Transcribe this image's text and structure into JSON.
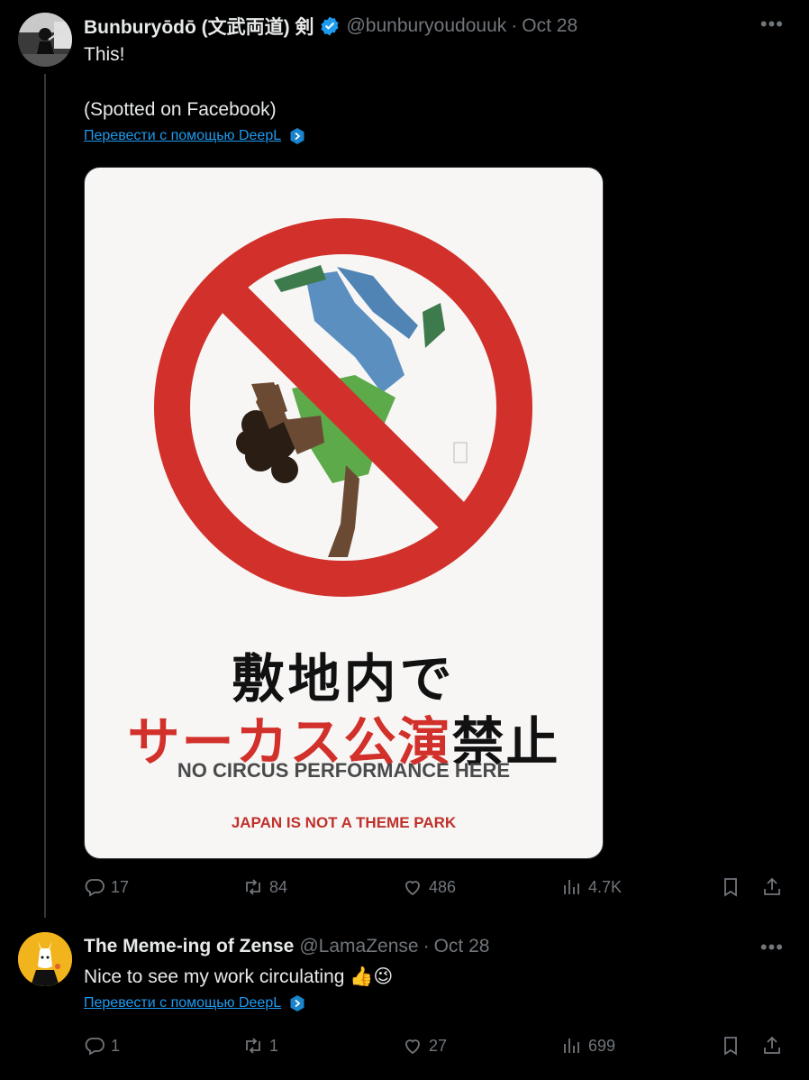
{
  "tweets": [
    {
      "name": "Bunburyōdō (文武両道) 剣",
      "handle": "@bunburyoudouuk",
      "separator": "·",
      "date": "Oct 28",
      "more_label": "•••",
      "text_lines": [
        "This!",
        "(Spotted on Facebook)"
      ],
      "translate_label": "Перевести с помощью DeepL",
      "poster": {
        "jp_line1": "敷地内で",
        "jp_line2_red": "サーカス公演",
        "jp_line2_black": "禁止",
        "en_line1": "NO CIRCUS PERFORMANCE HERE",
        "en_line2": "JAPAN IS NOT A THEME PARK"
      },
      "stats": {
        "replies": "17",
        "retweets": "84",
        "likes": "486",
        "views": "4.7K"
      }
    },
    {
      "name": "The Meme-ing of Zense",
      "handle": "@LamaZense",
      "separator": "·",
      "date": "Oct 28",
      "more_label": "•••",
      "text": "Nice to see my work circulating 👍😉",
      "translate_label": "Перевести с помощью DeepL",
      "stats": {
        "replies": "1",
        "retweets": "1",
        "likes": "27",
        "views": "699"
      }
    }
  ],
  "colors": {
    "accent": "#1d9bf0",
    "muted": "#71767b",
    "text": "#e7e9ea",
    "background": "#000000",
    "poster_red": "#d2302a"
  }
}
